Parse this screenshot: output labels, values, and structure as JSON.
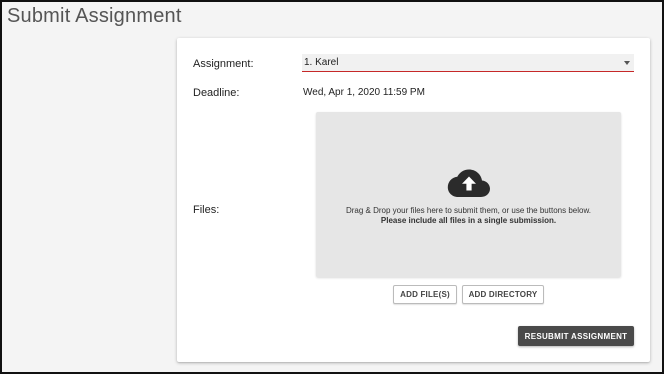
{
  "page": {
    "title": "Submit Assignment"
  },
  "form": {
    "assignment_label": "Assignment:",
    "assignment_value": "1. Karel",
    "deadline_label": "Deadline:",
    "deadline_value": "Wed, Apr 1, 2020 11:59 PM",
    "files_label": "Files:"
  },
  "dropzone": {
    "icon": "cloud-upload-icon",
    "line1": "Drag & Drop your files here to submit them, or use the buttons below.",
    "line2": "Please include all files in a single submission."
  },
  "buttons": {
    "add_files": "ADD FILE(S)",
    "add_directory": "ADD DIRECTORY",
    "resubmit": "RESUBMIT ASSIGNMENT"
  },
  "colors": {
    "select_underline": "#c62828",
    "primary_button": "#4a4a4a",
    "dropzone_bg": "#e6e6e6"
  }
}
